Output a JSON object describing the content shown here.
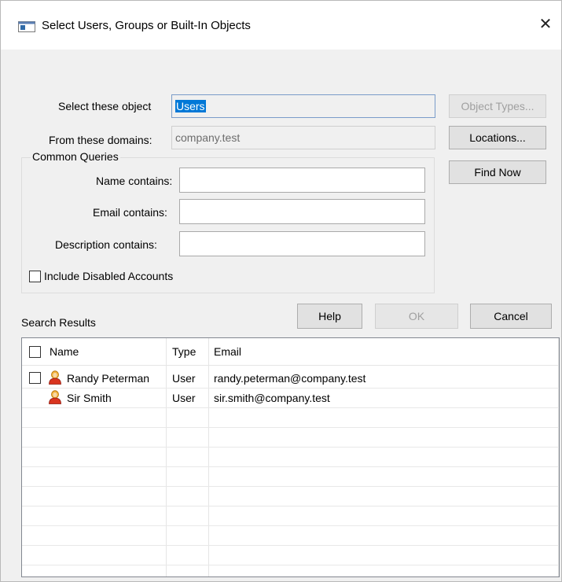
{
  "window": {
    "title": "Select Users, Groups or Built-In Objects"
  },
  "form": {
    "object_label": "Select these object",
    "object_value": "Users",
    "domains_label": "From these domains:",
    "domains_value": "company.test"
  },
  "side_buttons": {
    "object_types": "Object Types...",
    "locations": "Locations...",
    "find_now": "Find Now"
  },
  "queries": {
    "group_label": "Common Queries",
    "name_label": "Name contains:",
    "name_value": "",
    "email_label": "Email contains:",
    "email_value": "",
    "description_label": "Description contains:",
    "description_value": "",
    "disabled_label": "Include Disabled Accounts",
    "disabled_checked": false
  },
  "actions": {
    "help": "Help",
    "ok": "OK",
    "cancel": "Cancel"
  },
  "results": {
    "label": "Search Results",
    "columns": {
      "name": "Name",
      "type": "Type",
      "email": "Email"
    },
    "rows": [
      {
        "name": "Randy Peterman",
        "type": "User",
        "email": "randy.peterman@company.test",
        "has_checkbox": true
      },
      {
        "name": "Sir Smith",
        "type": "User",
        "email": "sir.smith@company.test",
        "has_checkbox": false
      }
    ]
  },
  "icons": {
    "window": "dialog-window-icon",
    "close": "close-icon",
    "user": "user-icon"
  },
  "colors": {
    "selection": "#0078d7",
    "dialog_bg": "#f0f0f0",
    "disabled_text": "#a0a0a0"
  }
}
